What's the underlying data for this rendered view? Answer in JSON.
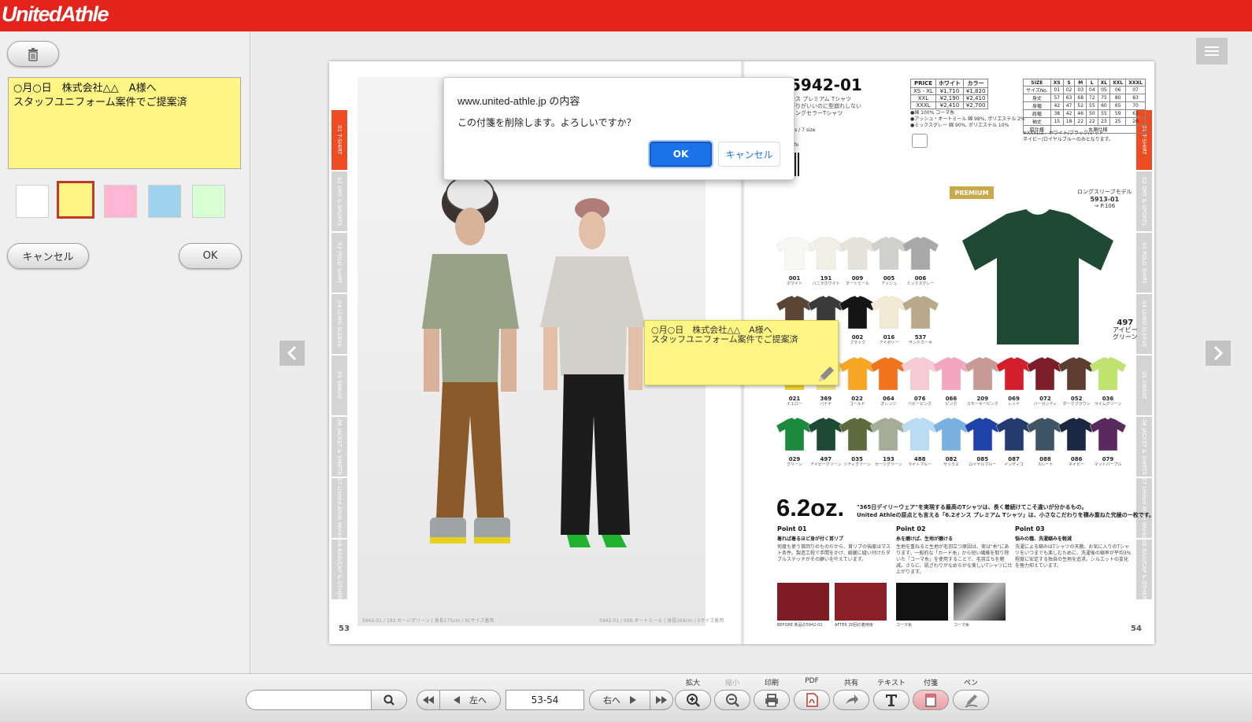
{
  "header": {
    "logo_text": "UnitedAthle"
  },
  "left_panel": {
    "note_text": "○月○日　株式会社△△　A様へ\nスタッフユニフォーム案件でご提案済",
    "swatches": [
      "#ffffff",
      "#fff585",
      "#ffb6d4",
      "#9fd2ef",
      "#d8ffd4"
    ],
    "selected_swatch": "#fff585",
    "cancel_label": "キャンセル",
    "ok_label": "OK"
  },
  "dialog": {
    "title": "www.united-athle.jp の内容",
    "message": "この付箋を削除します。よろしいですか？",
    "ok_label": "OK",
    "cancel_label": "キャンセル"
  },
  "sticky_note": {
    "text": "○月○日　株式会社△△　A様へ\nスタッフユニフォーム案件でご提案済"
  },
  "catalog": {
    "left_tabs": [
      "01 T-SHIRT",
      "02 DRY & SPORTS",
      "03 POLO SHIRT",
      "04 LONG SLEEVE",
      "05 SWEAT",
      "06 JACKET & SHIRTS",
      "07 United Athle Works",
      "08 BAG/CAP & OTHER"
    ],
    "left_page_number": "53",
    "right_page_number": "54",
    "photo_caption_left": "5942-01 / 193.セージグリーン | 身長175cm / XLサイズ着用",
    "photo_caption_right": "5942-01 / 009.オートミール | 身長169cm / Sサイズ着用",
    "product_code": "5942-01",
    "product_sub": "ンス プレミアム Tシャツ",
    "product_desc_1": "がりがいいのに型崩れしない",
    "product_desc_2": "ロングセラーTシャツ",
    "colors_sizes": "ors / 7 size",
    "info_label": "info",
    "price_table": [
      [
        "PRICE",
        "ホワイト",
        "カラー"
      ],
      [
        "XS - XL",
        "¥1,710",
        "¥1,820"
      ],
      [
        "XXL",
        "¥2,190",
        "¥2,410"
      ],
      [
        "XXXL",
        "¥2,410",
        "¥2,700"
      ]
    ],
    "size_table": [
      [
        "SIZE",
        "XS",
        "S",
        "M",
        "L",
        "XL",
        "XXL",
        "XXXL"
      ],
      [
        "サイズNo.",
        "01",
        "02",
        "03",
        "04",
        "05",
        "06",
        "07"
      ],
      [
        "身丈",
        "57",
        "63",
        "68",
        "72",
        "75",
        "80",
        "83"
      ],
      [
        "身幅",
        "42",
        "47",
        "52",
        "55",
        "60",
        "65",
        "70"
      ],
      [
        "肩幅",
        "38",
        "42",
        "46",
        "50",
        "55",
        "59",
        "61"
      ],
      [
        "袖丈",
        "15",
        "18",
        "22",
        "22",
        "23",
        "25",
        "26"
      ],
      [
        "脇仕様",
        "丸胴仕様"
      ]
    ],
    "material_notes": [
      "●綿 100% コーマ糸",
      "●アッシュ・オートミール 綿 98%, ポリエステル 2%",
      "●ミックスグレー 綿 90%, ポリエステル 10%"
    ],
    "size_note_1": "※XXXLは、ホワイト/ブラック/レッド",
    "size_note_2": "ネイビー/ロイヤルブルーのみとなります。",
    "premium_label": "PREMIUM",
    "model_ref": [
      "ロングスリーブモデル",
      "5913-01",
      "→ P.106"
    ],
    "featured": {
      "code": "497",
      "name_1": "アイビー",
      "name_2": "グリーン",
      "color": "#1e4a33"
    },
    "colors": [
      {
        "code": "001",
        "name": "ホワイト",
        "hex": "#f7f7f5"
      },
      {
        "code": "191",
        "name": "バニラホワイト",
        "hex": "#f1efe6"
      },
      {
        "code": "009",
        "name": "オートミール",
        "hex": "#e5e2da"
      },
      {
        "code": "005",
        "name": "アッシュ",
        "hex": "#cfcfcd"
      },
      {
        "code": "006",
        "name": "ミックスグレー",
        "hex": "#a8a8a8"
      },
      {
        "code": "",
        "name": "",
        "hex": "#5b4634"
      },
      {
        "code": "",
        "name": "",
        "hex": "#3a3a3a"
      },
      {
        "code": "002",
        "name": "ブラック",
        "hex": "#151515"
      },
      {
        "code": "016",
        "name": "アイボリー",
        "hex": "#f3ead6"
      },
      {
        "code": "537",
        "name": "サンドカーキ",
        "hex": "#b9a88a"
      },
      {
        "code": "021",
        "name": "イエロー",
        "hex": "#f2d52a"
      },
      {
        "code": "369",
        "name": "バナナ",
        "hex": "#f7e889"
      },
      {
        "code": "022",
        "name": "ゴールド",
        "hex": "#f6a623"
      },
      {
        "code": "064",
        "name": "オレンジ",
        "hex": "#f2731d"
      },
      {
        "code": "076",
        "name": "ベビーピンク",
        "hex": "#f6ccd4"
      },
      {
        "code": "066",
        "name": "ピンク",
        "hex": "#f3a6c0"
      },
      {
        "code": "209",
        "name": "スモーキーピンク",
        "hex": "#c89a96"
      },
      {
        "code": "069",
        "name": "レッド",
        "hex": "#d21f2b"
      },
      {
        "code": "072",
        "name": "バーガンディ",
        "hex": "#7c1d2a"
      },
      {
        "code": "052",
        "name": "ダークブラウン",
        "hex": "#5c3d2e"
      },
      {
        "code": "036",
        "name": "ライムグリーン",
        "hex": "#bfe36c"
      },
      {
        "code": "029",
        "name": "グリーン",
        "hex": "#1c8a3d"
      },
      {
        "code": "497",
        "name": "アイビーグリーン",
        "hex": "#1e4a33"
      },
      {
        "code": "035",
        "name": "シティグリーン",
        "hex": "#5c6b3b"
      },
      {
        "code": "193",
        "name": "セージグリーン",
        "hex": "#a6ad96"
      },
      {
        "code": "488",
        "name": "ライトブルー",
        "hex": "#b9dcf2"
      },
      {
        "code": "082",
        "name": "サックス",
        "hex": "#7bb1e0"
      },
      {
        "code": "085",
        "name": "ロイヤルブルー",
        "hex": "#1f43a8"
      },
      {
        "code": "087",
        "name": "インディゴ",
        "hex": "#253a6e"
      },
      {
        "code": "088",
        "name": "スレート",
        "hex": "#3f5566"
      },
      {
        "code": "086",
        "name": "ネイビー",
        "hex": "#1c2742"
      },
      {
        "code": "079",
        "name": "マットパープル",
        "hex": "#5a2a5e"
      }
    ],
    "weight": "6.2oz.",
    "weight_desc_1": "\"365日デイリーウェア\"を実現する最高のTシャツは、長く着続けてこそ違いが分かるもの。",
    "weight_desc_2": "United Athleの原点とも言える「6.2オンス プレミアム Tシャツ」は、小さなこだわりを積み重ねた究極の一枚です。",
    "points": [
      {
        "title": "Point 01",
        "head": "着れば着るほど身が付く首リブ",
        "body": "何度も使う首回りのものだから、首リブの強度はマスト条件。製造工程で手間をかけ、綺麗に縫い付けたダブルステッチがその顧いを叶えています。"
      },
      {
        "title": "Point 02",
        "head": "糸を磨けば、生地が磨ける",
        "body": "生地を重ねると生地が毛羽立つ原因は、実は\"糸\"にあります。一般的な「カード糸」から短い繊維を取り除いた「コーマ糸」を使用することで、毛羽立ちを軽減。さらに、肌ざわりがなめらかな美しいTシャツに仕上がります。"
      },
      {
        "title": "Point 03",
        "head": "悩みの種、洗濯縮みを軽減",
        "body": "洗濯による縮みはTシャツの天敵。お気に入りのTシャツをいつまでも楽しむために、洗濯後の縮率が平均3%程度に安定する独自の生地を追求。シルエットの変化を極力抑えています。"
      }
    ],
    "detail_captions": [
      "BEFORE 新品の5942-01",
      "AFTER 20回の着用後",
      "コーマ糸",
      "コーマ糸"
    ]
  },
  "toolbar": {
    "search_placeholder": "",
    "prev_label": "左へ",
    "next_label": "右へ",
    "page_value": "53-54",
    "tools": [
      {
        "label": "拡大",
        "icon": "zoom-in-icon",
        "dim": false
      },
      {
        "label": "縮小",
        "icon": "zoom-out-icon",
        "dim": true
      },
      {
        "label": "印刷",
        "icon": "print-icon",
        "dim": false
      },
      {
        "label": "PDF",
        "icon": "pdf-icon",
        "dim": false
      },
      {
        "label": "共有",
        "icon": "share-icon",
        "dim": false
      },
      {
        "label": "テキスト",
        "icon": "text-icon",
        "dim": false
      },
      {
        "label": "付箋",
        "icon": "sticky-note-icon",
        "dim": false
      },
      {
        "label": "ペン",
        "icon": "pen-icon",
        "dim": false
      }
    ],
    "active_tool": "付箋"
  }
}
